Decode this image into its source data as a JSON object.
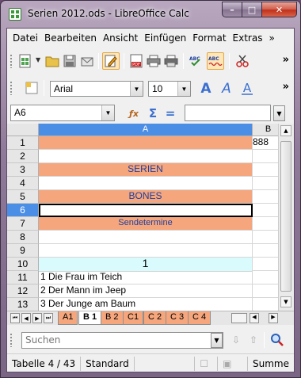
{
  "window": {
    "title": "Serien 2012.ods - LibreOffice Calc",
    "minimize": "–",
    "maximize": "□",
    "close": "✕"
  },
  "menu": {
    "items": [
      "Datei",
      "Bearbeiten",
      "Ansicht",
      "Einfügen",
      "Format",
      "Extras"
    ],
    "overflow": "»"
  },
  "toolbar": {
    "font_name": "Arial",
    "font_size": "10",
    "overflow": "»"
  },
  "formula": {
    "name_box": "A6",
    "sum_icon": "Σ",
    "equals_icon": "=",
    "input": ""
  },
  "grid": {
    "columns": [
      "A",
      "B"
    ],
    "rows": [
      {
        "num": "1",
        "a": "",
        "b": "888",
        "style": "orange"
      },
      {
        "num": "2",
        "a": "",
        "b": "",
        "style": ""
      },
      {
        "num": "3",
        "a": "SERIEN",
        "b": "",
        "style": "orange"
      },
      {
        "num": "4",
        "a": "",
        "b": "",
        "style": ""
      },
      {
        "num": "5",
        "a": "BONES",
        "b": "",
        "style": "orange"
      },
      {
        "num": "6",
        "a": "",
        "b": "",
        "style": "selected"
      },
      {
        "num": "7",
        "a": "Sendetermine",
        "b": "",
        "style": "orange"
      },
      {
        "num": "8",
        "a": "",
        "b": "",
        "style": ""
      },
      {
        "num": "9",
        "a": "",
        "b": "",
        "style": ""
      },
      {
        "num": "10",
        "a": "1",
        "b": "",
        "style": "cyan"
      },
      {
        "num": "11",
        "a": "1  Die Frau im Teich",
        "b": "",
        "style": ""
      },
      {
        "num": "12",
        "a": "2  Der Mann im Jeep",
        "b": "",
        "style": ""
      },
      {
        "num": "13",
        "a": "3  Der Junge am Baum",
        "b": "",
        "style": ""
      }
    ]
  },
  "sheets": {
    "tabs": [
      "A1",
      "B 1",
      "B 2",
      "C1",
      "C 2",
      "C 3",
      "C 4"
    ],
    "active": "B 1"
  },
  "find": {
    "placeholder": "Suchen"
  },
  "status": {
    "sheet": "Tabelle 4 / 43",
    "page_style": "Standard",
    "sum": "Summe"
  },
  "colors": {
    "orange_fill": "#f5a67d",
    "cyan_fill": "#d9fbfd",
    "header_blue": "#4b8ee6",
    "text_blue": "#1f3f9e"
  }
}
